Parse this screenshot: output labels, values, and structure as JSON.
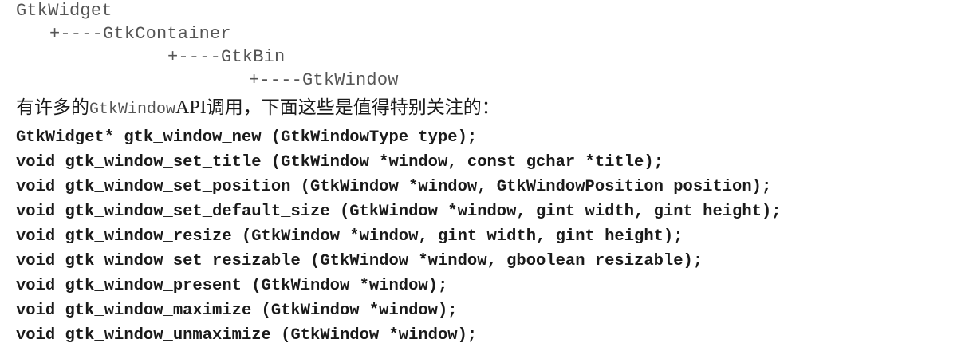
{
  "hierarchy": [
    "GtkWidget",
    "+----GtkContainer",
    "+----GtkBin",
    "+----GtkWindow"
  ],
  "intro": {
    "text_before": "有许多的",
    "class_name": "GtkWindow",
    "api": "API",
    "text_after": "调用，下面这些是值得特别关注的："
  },
  "functions": [
    "GtkWidget* gtk_window_new (GtkWindowType type);",
    "void gtk_window_set_title (GtkWindow *window, const gchar *title);",
    "void gtk_window_set_position (GtkWindow *window, GtkWindowPosition position);",
    "void gtk_window_set_default_size (GtkWindow *window, gint width, gint height);",
    "void gtk_window_resize (GtkWindow *window, gint width, gint height);",
    "void gtk_window_set_resizable (GtkWindow *window, gboolean resizable);",
    "void gtk_window_present (GtkWindow *window);",
    "void gtk_window_maximize (GtkWindow *window);",
    "void gtk_window_unmaximize (GtkWindow *window);"
  ]
}
